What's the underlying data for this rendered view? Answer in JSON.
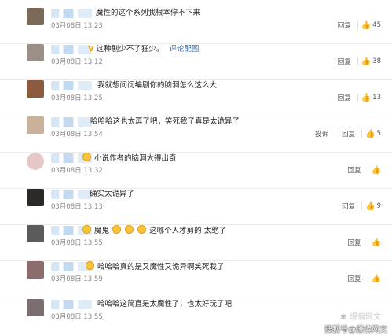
{
  "actions": {
    "reply": "回复",
    "report": "投诉"
  },
  "comments": [
    {
      "text": "魔性的这个系列我根本停不下来",
      "time": "03月08日 13:23",
      "likes": "45",
      "avatar_color": "#7b6a5a"
    },
    {
      "text": "这种剧少不了狂少。",
      "more": "评论配图",
      "time": "03月08日 13:12",
      "likes": "38",
      "avatar_color": "#9a8e86"
    },
    {
      "text": "我就想问问编剧你的脑洞怎么这么大",
      "time": "03月08日 13:25",
      "likes": "13",
      "avatar_color": "#8c5a3e"
    },
    {
      "text": "哈哈哈这也太逗了吧，笑死我了真是太诡异了",
      "time": "03月08日 13:54",
      "likes": "5",
      "avatar_color": "#c9b19a"
    },
    {
      "text": "小说作者的脑洞大得出奇",
      "time": "03月08日 13:32",
      "likes": "",
      "avatar_color": "#e6c7c7"
    },
    {
      "text": "确实太诡异了",
      "time": "03月08日 13:13",
      "likes": "9",
      "avatar_color": "#2c2a26"
    },
    {
      "text": "魔鬼",
      "text2": "这哪个人才剪的 太绝了",
      "time": "03月08日 13:55",
      "likes": "",
      "avatar_color": "#5b5b5b"
    },
    {
      "text": "哈哈哈真的是又魔性又诡异啊笑死我了",
      "time": "03月08日 13:59",
      "likes": "",
      "avatar_color": "#8c6c6c"
    },
    {
      "text": "哈哈哈这简直是太魔性了，也太好玩了吧",
      "time": "03月08日 13:55",
      "likes": "",
      "avatar_color": "#7b6e6e"
    }
  ],
  "watermark": {
    "top": "爆偏网文",
    "bottom": "搜狐号@爆偏网文"
  },
  "colors": {
    "link": "#2a6fb6",
    "time": "#888888",
    "divider": "#ececec"
  }
}
